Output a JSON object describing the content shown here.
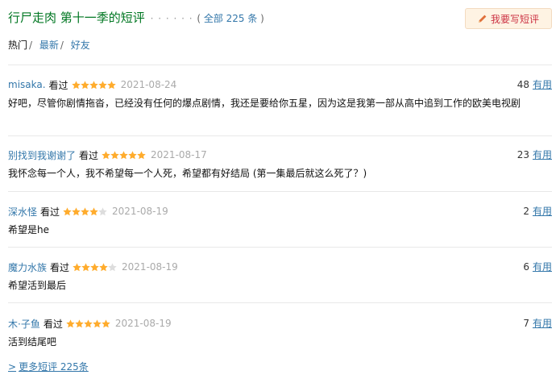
{
  "header": {
    "title": "行尸走肉 第十一季的短评",
    "dots": "· · · · · ·",
    "total_prefix": "( ",
    "total_link": "全部 225 条",
    "total_suffix": " )",
    "write_button": "我要写短评",
    "write_icon": "pencil-icon"
  },
  "tabs": [
    {
      "label": "热门",
      "active": true
    },
    {
      "label": "最新",
      "active": false
    },
    {
      "label": "好友",
      "active": false
    }
  ],
  "tab_separator": "/",
  "comments": [
    {
      "user": "misaka.",
      "status": "看过",
      "rating": 5,
      "date": "2021-08-24",
      "votes": "48",
      "useful": "有用",
      "text": "好吧，尽管你剧情拖沓，已经没有任何的爆点剧情，我还是要给你五星，因为这是我第一部从高中追到工作的欧美电视剧"
    },
    {
      "user": "别找到我谢谢了",
      "status": "看过",
      "rating": 5,
      "date": "2021-08-17",
      "votes": "23",
      "useful": "有用",
      "text": "我怀念每一个人，我不希望每一个人死，希望都有好结局 (第一集最后就这么死了？)"
    },
    {
      "user": "深水怪",
      "status": "看过",
      "rating": 4,
      "date": "2021-08-19",
      "votes": "2",
      "useful": "有用",
      "text": "希望是he"
    },
    {
      "user": "魔力水族",
      "status": "看过",
      "rating": 4,
      "date": "2021-08-19",
      "votes": "6",
      "useful": "有用",
      "text": "希望活到最后"
    },
    {
      "user": "木·子鱼",
      "status": "看过",
      "rating": 5,
      "date": "2021-08-19",
      "votes": "7",
      "useful": "有用",
      "text": "活到结尾吧"
    }
  ],
  "more_link": {
    "arrow": ">",
    "label": "更多短评 225条"
  },
  "colors": {
    "title": "#007722",
    "link": "#3377aa",
    "star": "#ffac2d",
    "star_empty": "#dddddd",
    "button_bg": "#fef3e3",
    "button_text": "#cc3344"
  }
}
